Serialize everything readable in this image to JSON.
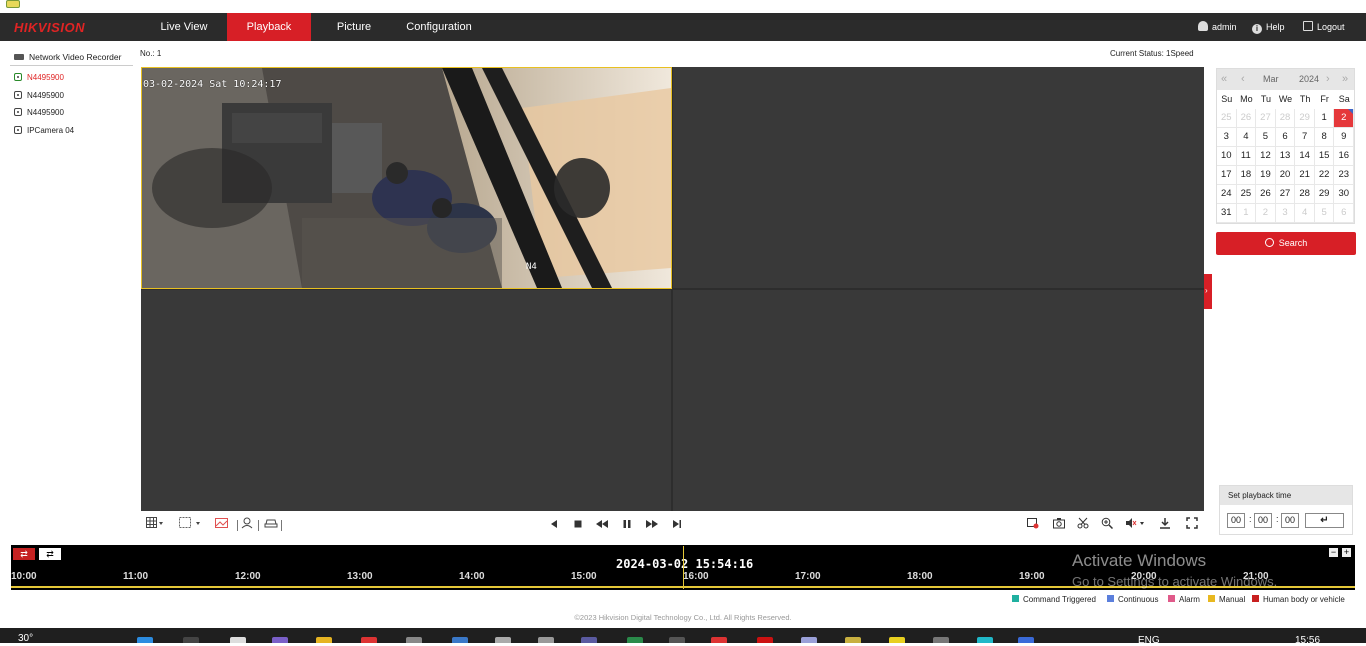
{
  "brand": {
    "logo": "HIKVISION"
  },
  "nav": {
    "tabs": [
      {
        "label": "Live View"
      },
      {
        "label": "Playback"
      },
      {
        "label": "Picture"
      },
      {
        "label": "Configuration"
      }
    ],
    "active_tab": "Playback",
    "user": "admin",
    "help": "Help",
    "logout": "Logout"
  },
  "sidebar": {
    "title": "Network Video Recorder",
    "cameras": [
      {
        "label": "N4495900",
        "active": true
      },
      {
        "label": "N4495900",
        "active": false
      },
      {
        "label": "N4495900",
        "active": false
      },
      {
        "label": "IPCamera 04",
        "active": false
      }
    ]
  },
  "viewer": {
    "no_label": "No.: 1",
    "status": "Current Status: 1Speed",
    "osd_timestamp": "03-02-2024 Sat 10:24:17",
    "osd_channel": "N4"
  },
  "calendar": {
    "month": "Mar",
    "year": "2024",
    "weekdays": [
      "Su",
      "Mo",
      "Tu",
      "We",
      "Th",
      "Fr",
      "Sa"
    ],
    "weeks": [
      [
        "25",
        "26",
        "27",
        "28",
        "29",
        "1",
        "2"
      ],
      [
        "3",
        "4",
        "5",
        "6",
        "7",
        "8",
        "9"
      ],
      [
        "10",
        "11",
        "12",
        "13",
        "14",
        "15",
        "16"
      ],
      [
        "17",
        "18",
        "19",
        "20",
        "21",
        "22",
        "23"
      ],
      [
        "24",
        "25",
        "26",
        "27",
        "28",
        "29",
        "30"
      ],
      [
        "31",
        "1",
        "2",
        "3",
        "4",
        "5",
        "6"
      ]
    ],
    "selected_day": "2",
    "search_label": "Search"
  },
  "playback_time": {
    "title": "Set playback time",
    "hh": "00",
    "mm": "00",
    "ss": "00",
    "go_symbol": "↵"
  },
  "timeline": {
    "current": "2024-03-02 15:54:16",
    "ticks": [
      "10:00",
      "11:00",
      "12:00",
      "13:00",
      "14:00",
      "15:00",
      "16:00",
      "17:00",
      "18:00",
      "19:00",
      "20:00",
      "21:00"
    ]
  },
  "legend": [
    {
      "label": "Command Triggered",
      "color": "#20b0a0"
    },
    {
      "label": "Continuous",
      "color": "#5b7fdc"
    },
    {
      "label": "Alarm",
      "color": "#e05a8a"
    },
    {
      "label": "Manual",
      "color": "#e8b820"
    },
    {
      "label": "Human body or vehicle",
      "color": "#c82020"
    }
  ],
  "watermark": {
    "line1": "Activate Windows",
    "line2": "Go to Settings to activate Windows."
  },
  "footer": "©2023 Hikvision Digital Technology Co., Ltd. All Rights Reserved.",
  "taskbar": {
    "temperature": "30°",
    "language": "ENG",
    "clock": "15:56"
  },
  "colors": {
    "brand_red": "#d71f26",
    "timeline_yellow": "#e5c838",
    "nav_bg": "#2b2b2b"
  }
}
